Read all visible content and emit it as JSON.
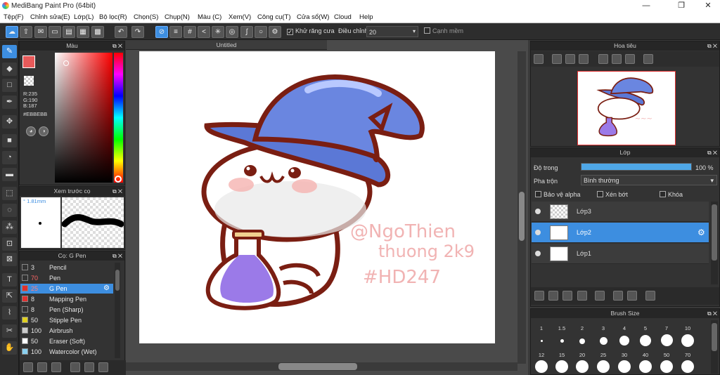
{
  "app": {
    "title": "MediBang Paint Pro (64bit)"
  },
  "menu": [
    "Tệp(F)",
    "Chỉnh sửa(E)",
    "Lớp(L)",
    "Bộ lọc(R)",
    "Chọn(S)",
    "Chụp(N)",
    "Màu (C)",
    "Xem(V)",
    "Công cụ(T)",
    "Cửa sổ(W)",
    "Cloud",
    "Help"
  ],
  "toolbar": {
    "antialias_label": "Khử răng cưa",
    "adjust_label": "Điều chỉnh",
    "adjust_value": "20",
    "smooth_label": "Cạnh mềm"
  },
  "color_panel": {
    "title": "Màu",
    "r": "R:235",
    "g": "G:190",
    "b": "B:187",
    "hex": "#EBBEBB",
    "primary": "#e85a5a"
  },
  "preview_panel": {
    "title": "Xem trước cọ",
    "size": "1.81mm"
  },
  "brush_panel": {
    "title": "Cọ: G Pen",
    "items": [
      {
        "size": "3",
        "name": "Pencil",
        "color": "#333333"
      },
      {
        "size": "70",
        "name": "Pen",
        "color": "#333333"
      },
      {
        "size": "25",
        "name": "G Pen",
        "color": "#e03030"
      },
      {
        "size": "8",
        "name": "Mapping Pen",
        "color": "#e03030"
      },
      {
        "size": "8",
        "name": "Pen (Sharp)",
        "color": "#333333"
      },
      {
        "size": "50",
        "name": "Stipple Pen",
        "color": "#e0d020"
      },
      {
        "size": "100",
        "name": "Airbrush",
        "color": "#cccccc"
      },
      {
        "size": "50",
        "name": "Eraser (Soft)",
        "color": "#ffffff"
      },
      {
        "size": "100",
        "name": "Watercolor (Wet)",
        "color": "#8ad0f0"
      }
    ]
  },
  "canvas": {
    "tab": "Untitled",
    "watermark": [
      "@NgoThien",
      "thuong 2k9",
      "#HD247"
    ]
  },
  "navigator": {
    "title": "Hoa tiêu"
  },
  "layers": {
    "title": "Lớp",
    "opacity_label": "Độ trong",
    "opacity_value": "100 %",
    "blend_label": "Pha trộn",
    "blend_value": "Bình thường",
    "protect_alpha": "Bảo vệ alpha",
    "clipping": "Xén bớt",
    "lock": "Khóa",
    "items": [
      {
        "name": "Lớp3"
      },
      {
        "name": "Lớp2"
      },
      {
        "name": "Lớp1"
      }
    ]
  },
  "brush_size": {
    "title": "Brush Size",
    "row1": [
      "1",
      "1.5",
      "2",
      "3",
      "4",
      "5",
      "7",
      "10"
    ],
    "row2": [
      "12",
      "15",
      "20",
      "25",
      "30",
      "40",
      "50",
      "70"
    ]
  }
}
